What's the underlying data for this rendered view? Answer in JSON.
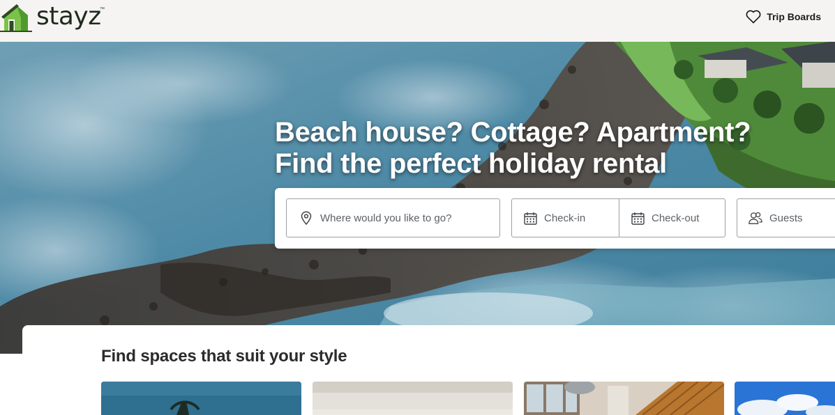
{
  "header": {
    "brand": "stayz",
    "trademark": "™",
    "trip_boards_label": "Trip Boards",
    "trip_boards_icon": "heart-icon"
  },
  "hero": {
    "headline_line1": "Beach house? Cottage? Apartment?",
    "headline_line2": "Find the perfect holiday rental"
  },
  "search": {
    "destination_placeholder": "Where would you like to go?",
    "destination_icon": "map-pin-icon",
    "checkin_label": "Check-in",
    "checkout_label": "Check-out",
    "date_icon": "calendar-icon",
    "guests_label": "Guests",
    "guests_icon": "people-icon"
  },
  "section": {
    "title": "Find spaces that suit your style",
    "tiles": [
      {
        "name": "tile-beach-palm"
      },
      {
        "name": "tile-interior-light"
      },
      {
        "name": "tile-timber-interior"
      },
      {
        "name": "tile-blue-sky"
      }
    ]
  },
  "colors": {
    "header_bg": "#f5f4f2",
    "text_dark": "#1b1b1b",
    "brand_green": "#6aa84f",
    "field_border": "#9aa0a6"
  }
}
